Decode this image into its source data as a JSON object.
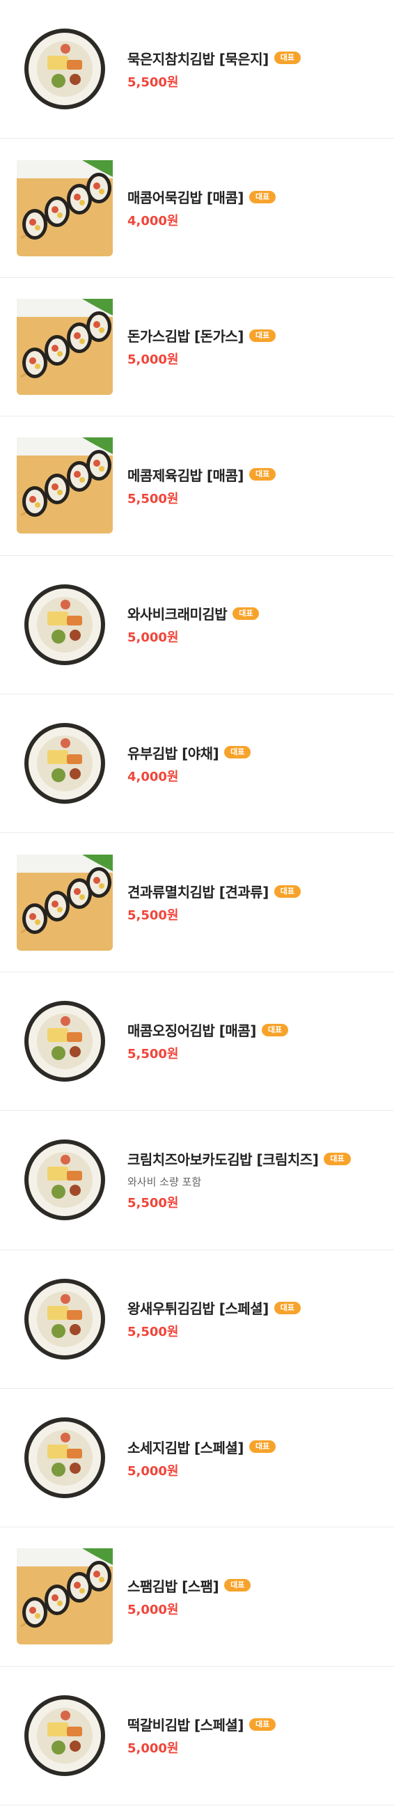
{
  "colors": {
    "badge": "#f7a32b",
    "price": "#f0453a",
    "name": "#222222",
    "divider": "#ececec"
  },
  "menu": [
    {
      "name": "묵은지참치김밥 [묵은지]",
      "badge": "대표",
      "description": "",
      "price": "5,500원",
      "photo": "round"
    },
    {
      "name": "매콤어묵김밥 [매콤]",
      "badge": "대표",
      "description": "",
      "price": "4,000원",
      "photo": "board"
    },
    {
      "name": "돈가스김밥 [돈가스]",
      "badge": "대표",
      "description": "",
      "price": "5,000원",
      "photo": "board"
    },
    {
      "name": "메콤제육김밥 [매콤]",
      "badge": "대표",
      "description": "",
      "price": "5,500원",
      "photo": "board"
    },
    {
      "name": "와사비크래미김밥",
      "badge": "대표",
      "description": "",
      "price": "5,000원",
      "photo": "round"
    },
    {
      "name": "유부김밥 [야채]",
      "badge": "대표",
      "description": "",
      "price": "4,000원",
      "photo": "round"
    },
    {
      "name": "견과류멸치김밥 [견과류]",
      "badge": "대표",
      "description": "",
      "price": "5,500원",
      "photo": "board"
    },
    {
      "name": "매콤오징어김밥 [매콤]",
      "badge": "대표",
      "description": "",
      "price": "5,500원",
      "photo": "round"
    },
    {
      "name": "크림치즈아보카도김밥 [크림치즈]",
      "badge": "대표",
      "description": "와사비 소량 포함",
      "price": "5,500원",
      "photo": "round"
    },
    {
      "name": "왕새우튀김김밥 [스페셜]",
      "badge": "대표",
      "description": "",
      "price": "5,500원",
      "photo": "round"
    },
    {
      "name": "소세지김밥 [스페셜]",
      "badge": "대표",
      "description": "",
      "price": "5,000원",
      "photo": "round"
    },
    {
      "name": "스팸김밥 [스팸]",
      "badge": "대표",
      "description": "",
      "price": "5,000원",
      "photo": "board"
    },
    {
      "name": "떡갈비김밥 [스페셜]",
      "badge": "대표",
      "description": "",
      "price": "5,000원",
      "photo": "round"
    }
  ]
}
